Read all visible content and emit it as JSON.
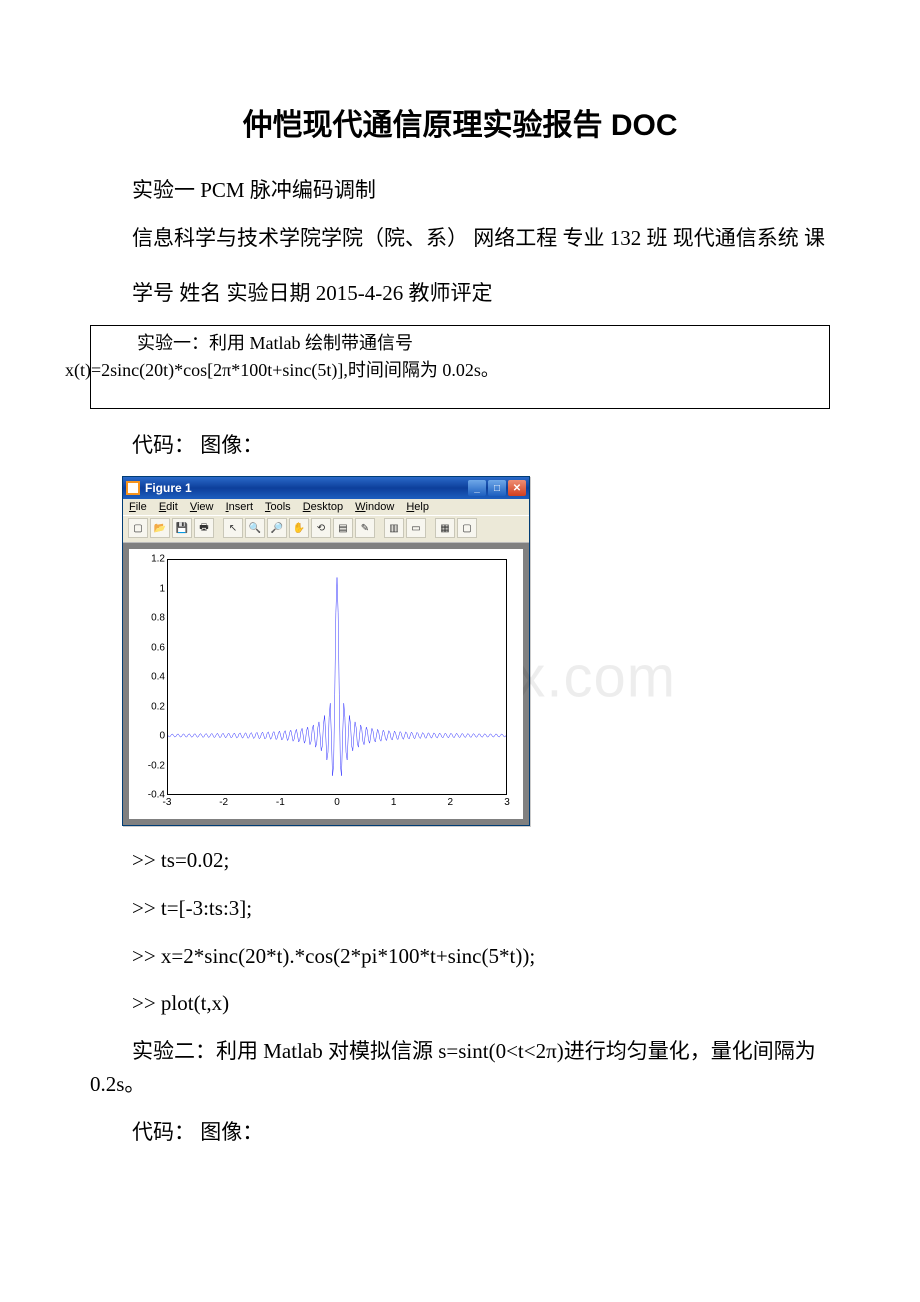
{
  "title": "仲恺现代通信原理实验报告 DOC",
  "p1": "实验一 PCM 脉冲编码调制",
  "p2": "信息科学与技术学院学院（院、系） 网络工程 专业 132 班  现代通信系统 课",
  "p3": "学号   姓名     实验日期 2015-4-26 教师评定",
  "box_line1": "实验一：利用 Matlab 绘制带通信号",
  "box_line2": "x(t)=2sinc(20t)*cos[2π*100t+sinc(5t)],时间间隔为 0.02s。",
  "p4": "代码：  图像：",
  "figwin": {
    "title": "Figure 1",
    "menus": [
      "File",
      "Edit",
      "View",
      "Insert",
      "Tools",
      "Desktop",
      "Window",
      "Help"
    ],
    "toolbar_icons": [
      "new-file-icon",
      "open-icon",
      "save-icon",
      "print-icon",
      "|",
      "pointer-icon",
      "zoom-in-icon",
      "zoom-out-icon",
      "pan-icon",
      "rotate-icon",
      "datacursor-icon",
      "brush-icon",
      "|",
      "colorbar-icon",
      "legend-icon",
      "|",
      "subplot-icon",
      "axes-icon"
    ]
  },
  "chart_data": {
    "type": "line",
    "title": "",
    "xlabel": "",
    "ylabel": "",
    "xlim": [
      -3,
      3
    ],
    "ylim": [
      -0.4,
      1.2
    ],
    "xticks": [
      -3,
      -2,
      -1,
      0,
      1,
      2,
      3
    ],
    "yticks": [
      -0.4,
      -0.2,
      0,
      0.2,
      0.4,
      0.6,
      0.8,
      1,
      1.2
    ],
    "description": "x(t)=2*sinc(20*t).*cos(2*pi*100*t+sinc(5*t)), ts=0.02, t=[-3:ts:3]",
    "series": [
      {
        "name": "x(t)",
        "color": "#0000ff",
        "formula": "2*sinc(20*t)*cos(2*pi*100*t+sinc(5*t))"
      }
    ]
  },
  "code1": ">> ts=0.02;",
  "code2": ">> t=[-3:ts:3];",
  "code3": ">> x=2*sinc(20*t).*cos(2*pi*100*t+sinc(5*t));",
  "code4": ">> plot(t,x)",
  "p5": "实验二：利用 Matlab 对模拟信源 s=sint(0<t<2π)进行均匀量化，量化间隔为 0.2s。",
  "p6": "代码：  图像：",
  "watermark": "www.bdocx.com"
}
